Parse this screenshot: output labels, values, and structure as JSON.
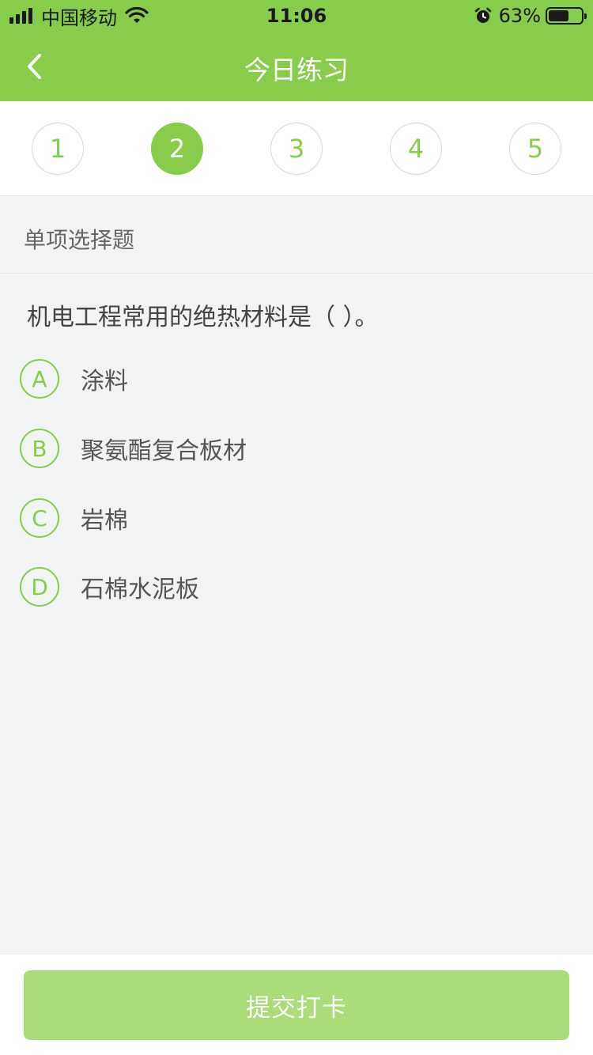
{
  "status_bar": {
    "carrier": "中国移动",
    "time": "11:06",
    "battery_percent_label": "63%",
    "battery_level": 0.63
  },
  "nav": {
    "title": "今日练习",
    "back_icon": "chevron-left-icon"
  },
  "question_numbers": {
    "items": [
      "1",
      "2",
      "3",
      "4",
      "5"
    ],
    "active_index": 1
  },
  "question": {
    "type_label": "单项选择题",
    "text": "机电工程常用的绝热材料是（ ）。",
    "options": [
      {
        "letter": "A",
        "text": "涂料"
      },
      {
        "letter": "B",
        "text": "聚氨酯复合板材"
      },
      {
        "letter": "C",
        "text": "岩棉"
      },
      {
        "letter": "D",
        "text": "石棉水泥板"
      }
    ]
  },
  "footer": {
    "submit_label": "提交打卡"
  },
  "colors": {
    "accent": "#87cc4b",
    "submit_disabled": "#aadc7a",
    "background": "#f2f3f5"
  }
}
